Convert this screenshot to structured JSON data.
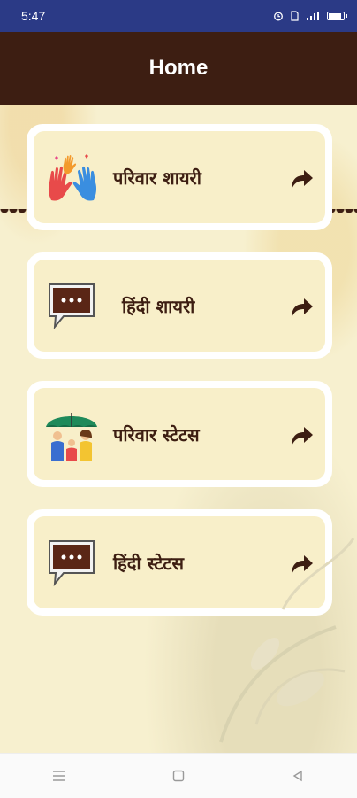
{
  "status_bar": {
    "time": "5:47",
    "icons": [
      "alarm-icon",
      "sim-icon",
      "signal-icon",
      "battery-icon"
    ]
  },
  "app_bar": {
    "title": "Home",
    "background": "#3d1e12"
  },
  "menu": {
    "items": [
      {
        "label": "परिवार शायरी",
        "icon": "colorful-hands-icon"
      },
      {
        "label": "हिंदी शायरी",
        "icon": "chat-bubble-icon"
      },
      {
        "label": "परिवार स्टेटस",
        "icon": "family-umbrella-icon"
      },
      {
        "label": "हिंदी स्टेटस",
        "icon": "chat-bubble-icon"
      }
    ],
    "arrow_icon": "share-arrow-icon",
    "text_color": "#3d1e12"
  },
  "nav_bar": {
    "icons": [
      "menu-icon",
      "home-square-icon",
      "back-triangle-icon"
    ]
  }
}
